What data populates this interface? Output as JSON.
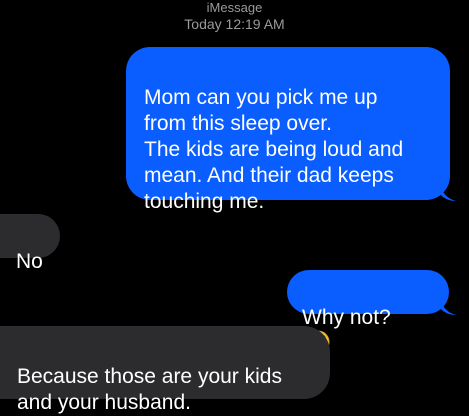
{
  "header": {
    "service": "iMessage",
    "timestamp": "Today 12:19 AM"
  },
  "messages": [
    {
      "direction": "sent",
      "text": "Mom can you pick me up\nfrom this sleep over.\nThe kids are being loud and\nmean. And their dad keeps\ntouching me."
    },
    {
      "direction": "received",
      "text": "No"
    },
    {
      "direction": "sent",
      "text": "Why not?",
      "emoji": "pleading-face-icon"
    },
    {
      "direction": "received",
      "text": "Because those are your kids\nand your husband."
    }
  ],
  "colors": {
    "background": "#000000",
    "sent_bubble": "#0a5dff",
    "received_bubble": "#2c2c2e",
    "header_text": "#9a9a9e"
  }
}
